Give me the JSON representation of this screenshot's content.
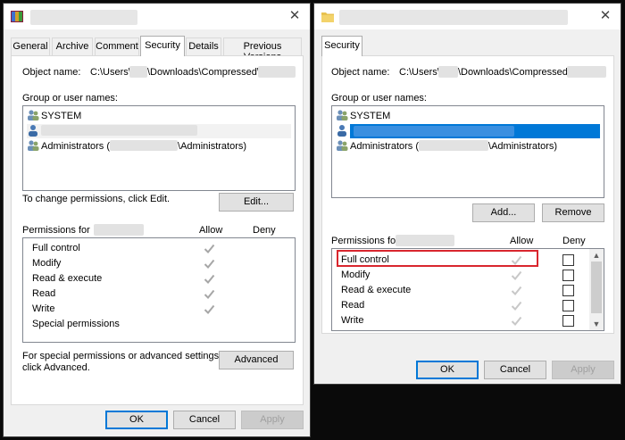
{
  "left_dialog": {
    "close_glyph": "✕",
    "tabs": [
      "General",
      "Archive",
      "Comment",
      "Security",
      "Details",
      "Previous Versions"
    ],
    "object_name_label": "Object name:",
    "object_name_path": {
      "prefix": "C:\\Users\\",
      "middle": "\\Downloads\\Compressed\\"
    },
    "group_label": "Group or user names:",
    "users": [
      {
        "name": "SYSTEM"
      },
      {
        "name": ""
      },
      {
        "name_prefix": "Administrators (",
        "name_suffix": "\\Administrators)"
      }
    ],
    "change_hint": "To change permissions, click Edit.",
    "edit_button": "Edit...",
    "permissions_for_label": "Permissions for",
    "allow_header": "Allow",
    "deny_header": "Deny",
    "permissions": [
      {
        "name": "Full control",
        "allow": true
      },
      {
        "name": "Modify",
        "allow": true
      },
      {
        "name": "Read & execute",
        "allow": true
      },
      {
        "name": "Read",
        "allow": true
      },
      {
        "name": "Write",
        "allow": true
      },
      {
        "name": "Special permissions",
        "allow": false
      }
    ],
    "advanced_hint_1": "For special permissions or advanced settings,",
    "advanced_hint_2": "click Advanced.",
    "advanced_button": "Advanced",
    "ok_button": "OK",
    "cancel_button": "Cancel",
    "apply_button": "Apply"
  },
  "right_dialog": {
    "close_glyph": "✕",
    "tab": "Security",
    "object_name_label": "Object name:",
    "object_name_path": {
      "prefix": "C:\\Users\\",
      "middle": "\\Downloads\\Compressed\\"
    },
    "group_label": "Group or user names:",
    "users": [
      {
        "name": "SYSTEM"
      },
      {
        "name": ""
      },
      {
        "name_prefix": "Administrators (",
        "name_suffix": "\\Administrators)"
      }
    ],
    "add_button": "Add...",
    "remove_button": "Remove",
    "permissions_for_label": "Permissions for",
    "allow_header": "Allow",
    "deny_header": "Deny",
    "permissions": [
      {
        "name": "Full control",
        "allow": true,
        "deny": false
      },
      {
        "name": "Modify",
        "allow": true,
        "deny": false
      },
      {
        "name": "Read & execute",
        "allow": true,
        "deny": false
      },
      {
        "name": "Read",
        "allow": true,
        "deny": false
      },
      {
        "name": "Write",
        "allow": true,
        "deny": false
      }
    ],
    "ok_button": "OK",
    "cancel_button": "Cancel",
    "apply_button": "Apply"
  },
  "colors": {
    "selection": "#0078d7",
    "highlight_box": "#d9262e",
    "check_enabled": "#a6a6a6",
    "check_disabled": "#c8c8c8"
  }
}
